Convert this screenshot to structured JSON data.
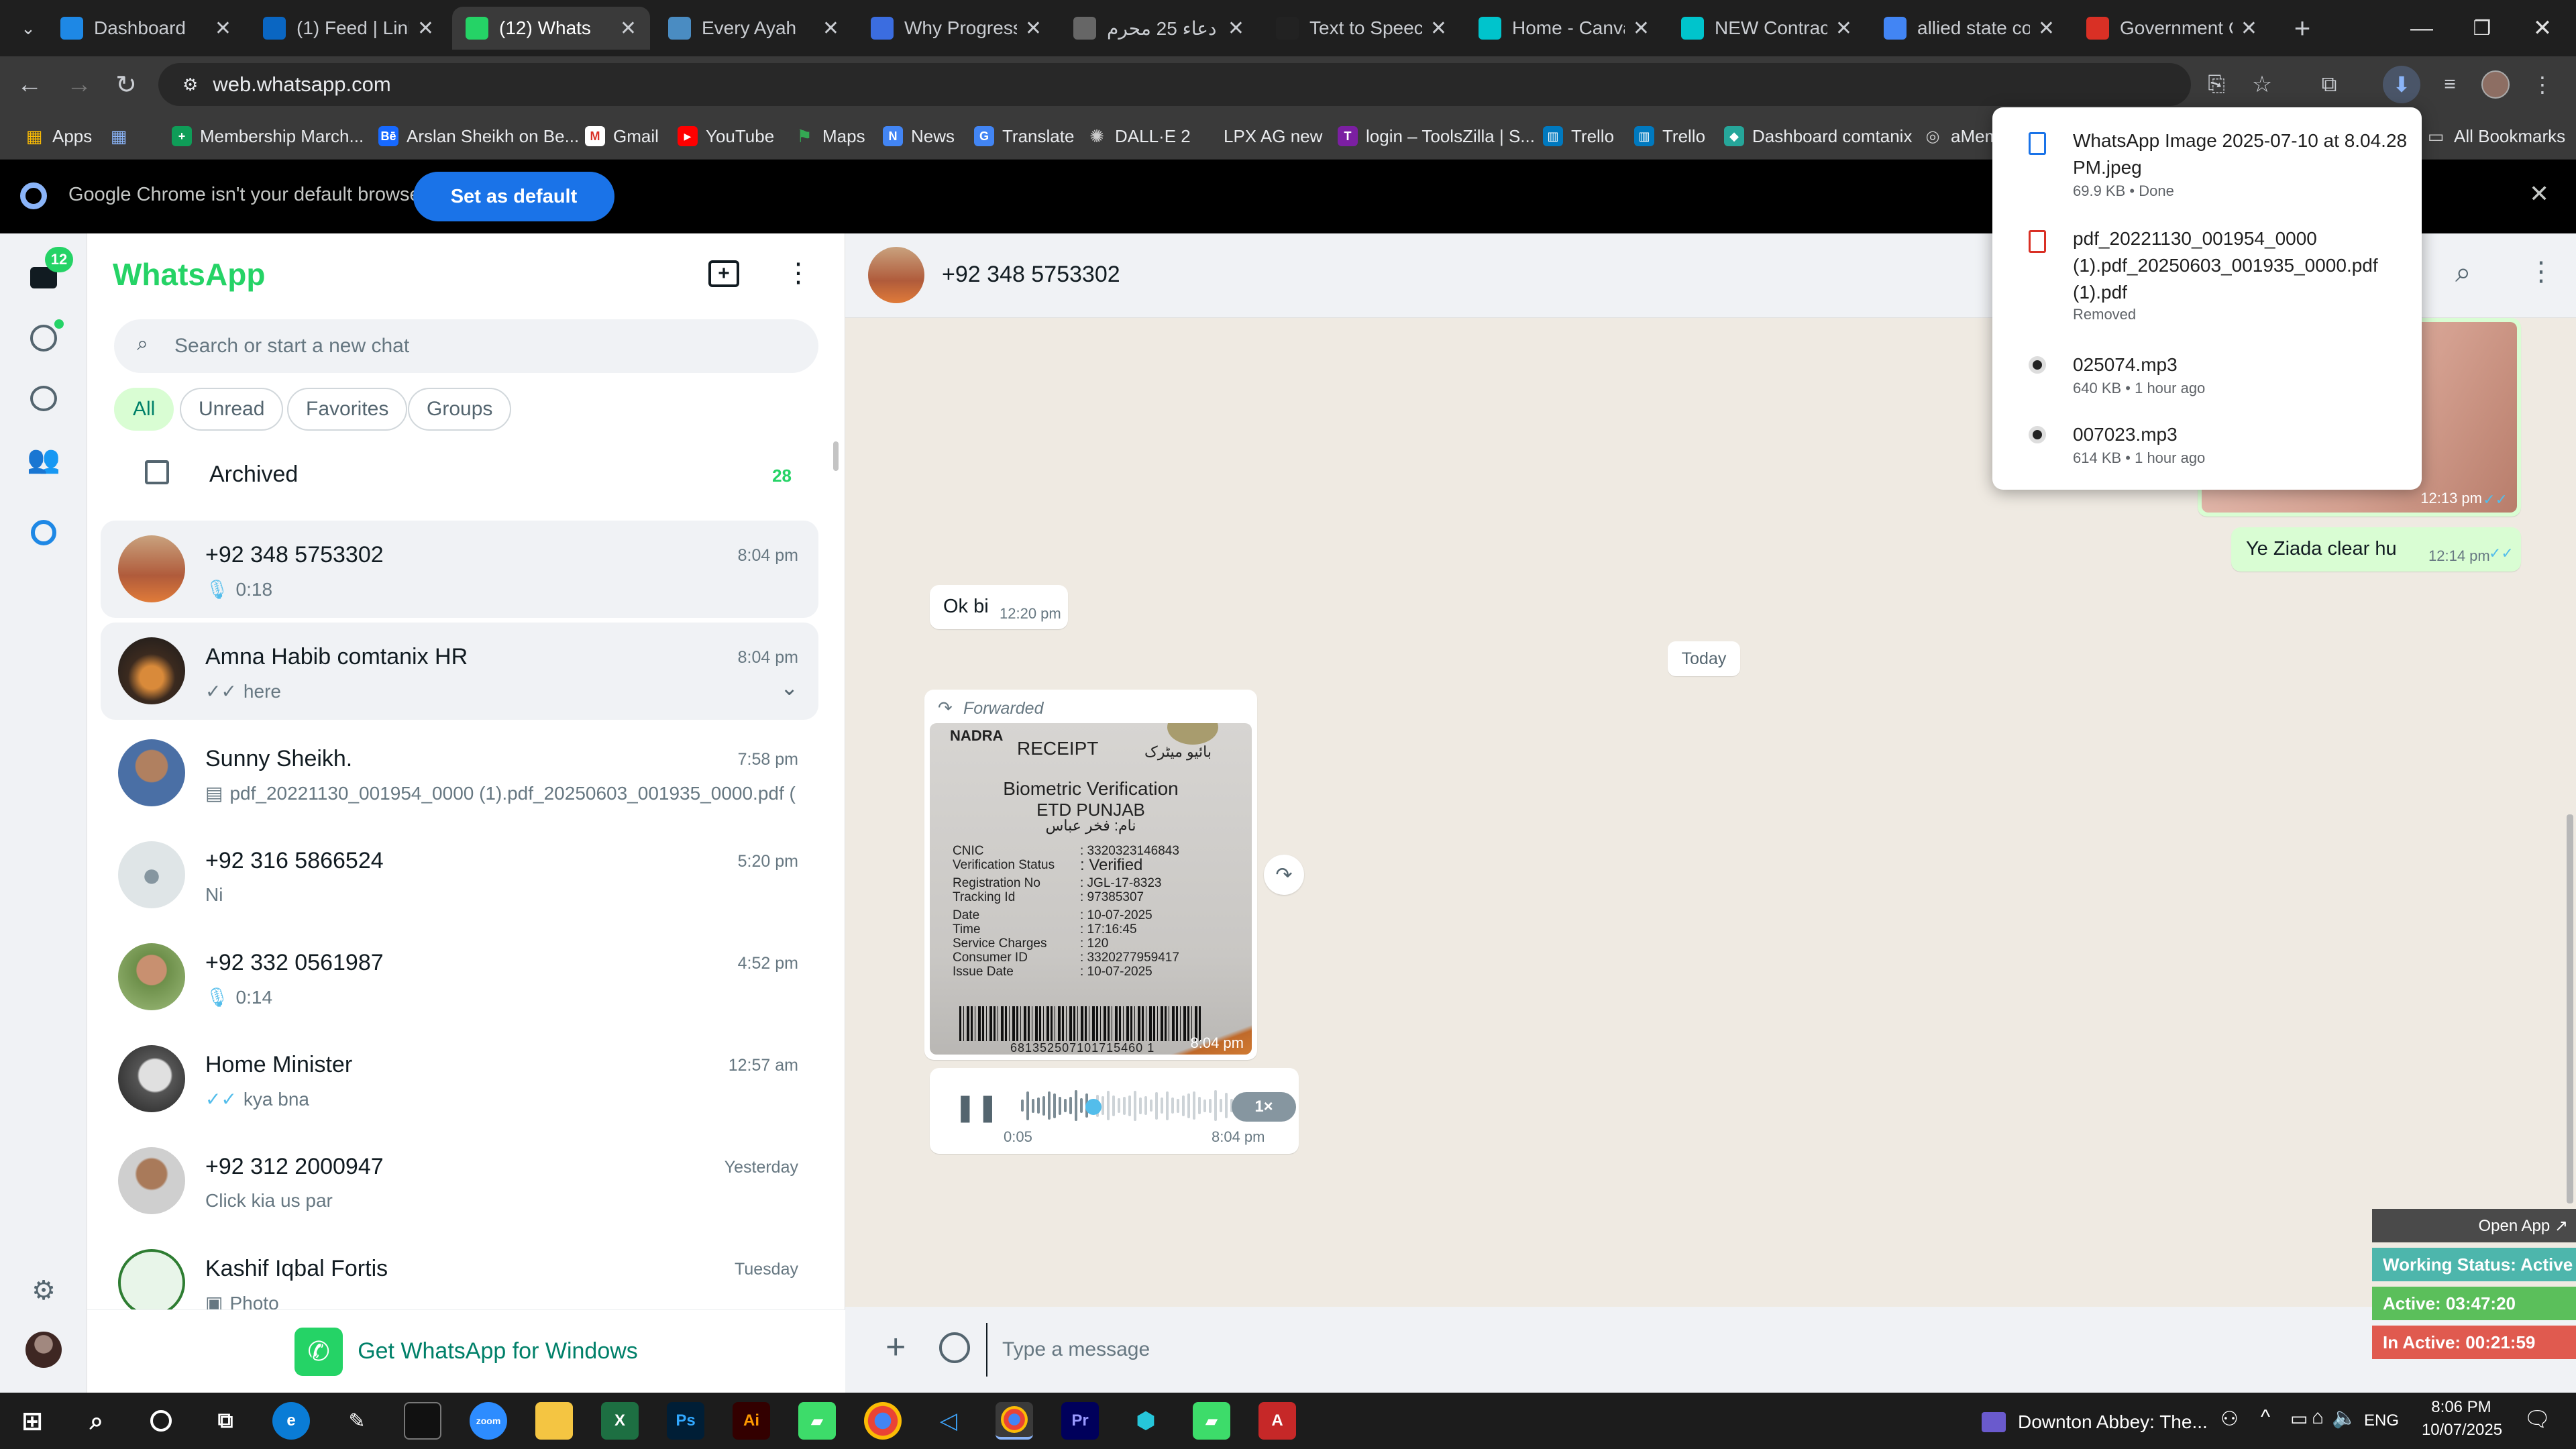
{
  "browser": {
    "tabs": [
      {
        "title": "Dashboard",
        "color": "#1e88e5",
        "icon": "dashboard-icon"
      },
      {
        "title": "(1) Feed | Linke",
        "color": "#0a66c2",
        "icon": "linkedin-icon"
      },
      {
        "title": "(12) Whats",
        "color": "#25d366",
        "icon": "whatsapp-icon"
      },
      {
        "title": "Every Ayah",
        "color": "#4a8cc2",
        "icon": "book-icon"
      },
      {
        "title": "Why Progressi",
        "color": "#3b6de0",
        "icon": "doc-icon"
      },
      {
        "title": "دعاء 25 محرم",
        "color": "#666666",
        "icon": "globe-icon"
      },
      {
        "title": "Text to Speech",
        "color": "#222222",
        "icon": "pause-icon"
      },
      {
        "title": "Home - Canva",
        "color": "#00c4cc",
        "icon": "canva-icon"
      },
      {
        "title": "NEW Contracts",
        "color": "#00c4cc",
        "icon": "canva-icon"
      },
      {
        "title": "allied state co",
        "color": "#4285f4",
        "icon": "google-icon"
      },
      {
        "title": "Government C",
        "color": "#d93025",
        "icon": "gov-icon"
      }
    ],
    "url": "web.whatsapp.com",
    "bookmarks": [
      "Apps",
      "Membership March...",
      "Arslan Sheikh on Be...",
      "Gmail",
      "YouTube",
      "Maps",
      "News",
      "Translate",
      "DALL·E 2",
      "LPX AG new",
      "login – ToolsZilla | S...",
      "Trello",
      "Trello",
      "Dashboard comtanix",
      "aMem",
      "All Bookmarks"
    ],
    "infobar_text": "Google Chrome isn't your default browser",
    "set_default_label": "Set as default"
  },
  "downloads": [
    {
      "name": "WhatsApp Image 2025-07-10 at 8.04.28 PM.jpeg",
      "meta": "69.9 KB • Done",
      "icon": "image-file-icon"
    },
    {
      "name": "pdf_20221130_001954_0000 (1).pdf_20250603_001935_0000.pdf (1).pdf",
      "meta": "Removed",
      "icon": "pdf-file-icon"
    },
    {
      "name": "025074.mp3",
      "meta": "640 KB • 1 hour ago",
      "icon": "audio-file-icon"
    },
    {
      "name": "007023.mp3",
      "meta": "614 KB • 1 hour ago",
      "icon": "audio-file-icon"
    }
  ],
  "whatsapp": {
    "title": "WhatsApp",
    "unread_badge": "12",
    "search_placeholder": "Search or start a new chat",
    "filters": [
      "All",
      "Unread",
      "Favorites",
      "Groups"
    ],
    "archived_label": "Archived",
    "archived_count": "28",
    "chats": [
      {
        "name": "+92 348 5753302",
        "time": "8:04 pm",
        "preview": "0:18",
        "kind": "voice"
      },
      {
        "name": "Amna Habib comtanix HR",
        "time": "8:04 pm",
        "preview": "here",
        "kind": "tick"
      },
      {
        "name": "Sunny Sheikh.",
        "time": "7:58 pm",
        "preview": "pdf_20221130_001954_0000 (1).pdf_20250603_001935_0000.pdf (...",
        "kind": "doc"
      },
      {
        "name": "+92 316 5866524",
        "time": "5:20 pm",
        "preview": "Ni",
        "kind": "text"
      },
      {
        "name": "+92 332 0561987",
        "time": "4:52 pm",
        "preview": "0:14",
        "kind": "voice"
      },
      {
        "name": "Home Minister",
        "time": "12:57 am",
        "preview": "kya bna",
        "kind": "tick"
      },
      {
        "name": "+92 312 2000947",
        "time": "Yesterday",
        "preview": "Click kia us par",
        "kind": "text"
      },
      {
        "name": "Kashif Iqbal Fortis",
        "time": "Tuesday",
        "preview": "Photo",
        "kind": "photo"
      }
    ],
    "get_windows": "Get WhatsApp for Windows",
    "conversation": {
      "contact": "+92 348 5753302",
      "messages": {
        "img_time": "12:13 pm",
        "out_text": "Ye Ziada clear hu",
        "out_time": "12:14 pm",
        "in_text": "Ok bi",
        "in_time": "12:20 pm",
        "date_chip": "Today",
        "forwarded": "Forwarded",
        "receipt_time": "8:04 pm",
        "voice_elapsed": "0:05",
        "voice_time": "8:04 pm",
        "voice_speed": "1×",
        "voice_progress": 0.3
      },
      "receipt": {
        "org": "NADRA",
        "heading": "RECEIPT",
        "title1": "Biometric Verification",
        "title2": "ETD PUNJAB",
        "urdu_name": "نام: فخر عباس",
        "fields": [
          [
            "CNIC",
            ": 3320323146843"
          ],
          [
            "Verification Status",
            ": Verified"
          ],
          [
            "Registration No",
            ": JGL-17-8323"
          ],
          [
            "Tracking Id",
            ": 97385307"
          ],
          [
            "Date",
            ": 10-07-2025"
          ],
          [
            "Time",
            ": 17:16:45"
          ],
          [
            "Service Charges",
            ": 120"
          ],
          [
            "Consumer ID",
            ": 3320277959417"
          ],
          [
            "Issue Date",
            ": 10-07-2025"
          ]
        ],
        "barcode_number": "681352507101715460 1"
      },
      "composer_placeholder": "Type a message"
    }
  },
  "widget": {
    "open_app": "Open App ↗",
    "working": "Working Status: Active",
    "active": "Active: 03:47:20",
    "inactive": "In Active: 00:21:59"
  },
  "taskbar": {
    "now_playing": "Downton Abbey: The...",
    "lang": "ENG",
    "time": "8:06 PM",
    "date": "10/07/2025"
  }
}
